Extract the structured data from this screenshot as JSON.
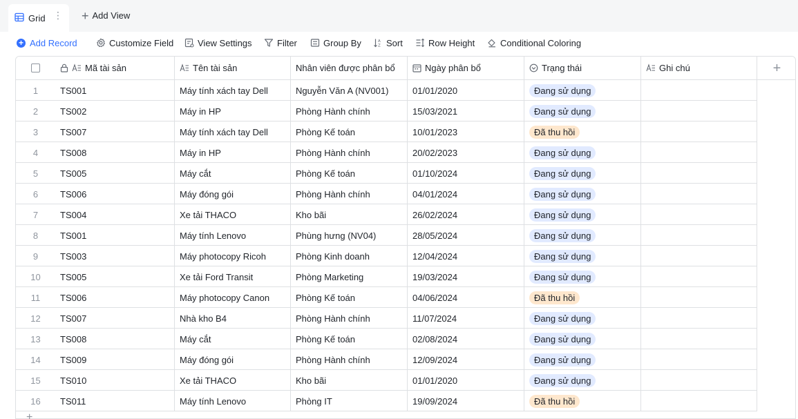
{
  "view": {
    "tab_label": "Grid",
    "more_label": "⋮",
    "add_view_label": "Add View"
  },
  "toolbar": {
    "add_record": "Add Record",
    "customize_field": "Customize Field",
    "view_settings": "View Settings",
    "filter": "Filter",
    "group_by": "Group By",
    "sort": "Sort",
    "row_height": "Row Height",
    "conditional_coloring": "Conditional Coloring"
  },
  "columns": {
    "ma_tai_san": "Mã tài sản",
    "ten_tai_san": "Tên tài sản",
    "nhan_vien": "Nhân viên được phân bổ",
    "ngay_phan_bo": "Ngày phân bổ",
    "trang_thai": "Trạng thái",
    "ghi_chu": "Ghi chú"
  },
  "colors": {
    "accent": "#3370ff",
    "status_in_use_bg": "#e1eaff",
    "status_recalled_bg": "#fee7cd",
    "border": "#dee0e3"
  },
  "rows": [
    {
      "num": "1",
      "code": "TS001",
      "name": "Máy tính xách tay Dell",
      "staff": "Nguyễn Văn A (NV001)",
      "date": "01/01/2020",
      "status": "Đang sử dụng",
      "status_kind": "blue",
      "note": ""
    },
    {
      "num": "2",
      "code": "TS002",
      "name": "Máy in HP",
      "staff": "Phòng Hành chính",
      "date": "15/03/2021",
      "status": "Đang sử dụng",
      "status_kind": "blue",
      "note": ""
    },
    {
      "num": "3",
      "code": "TS007",
      "name": "Máy tính xách tay Dell",
      "staff": "Phòng Kế toán",
      "date": "10/01/2023",
      "status": "Đã thu hồi",
      "status_kind": "orange",
      "note": ""
    },
    {
      "num": "4",
      "code": "TS008",
      "name": "Máy in HP",
      "staff": "Phòng Hành chính",
      "date": "20/02/2023",
      "status": "Đang sử dụng",
      "status_kind": "blue",
      "note": ""
    },
    {
      "num": "5",
      "code": "TS005",
      "name": "Máy cắt",
      "staff": "Phòng Kế toán",
      "date": "01/10/2024",
      "status": "Đang sử dụng",
      "status_kind": "blue",
      "note": ""
    },
    {
      "num": "6",
      "code": "TS006",
      "name": "Máy đóng gói",
      "staff": "Phòng Hành chính",
      "date": "04/01/2024",
      "status": "Đang sử dụng",
      "status_kind": "blue",
      "note": ""
    },
    {
      "num": "7",
      "code": "TS004",
      "name": "Xe tải THACO",
      "staff": "Kho bãi",
      "date": "26/02/2024",
      "status": "Đang sử dụng",
      "status_kind": "blue",
      "note": ""
    },
    {
      "num": "8",
      "code": "TS001",
      "name": "Máy tính Lenovo",
      "staff": "Phùng hưng (NV04)",
      "date": "28/05/2024",
      "status": "Đang sử dụng",
      "status_kind": "blue",
      "note": ""
    },
    {
      "num": "9",
      "code": "TS003",
      "name": "Máy photocopy Ricoh",
      "staff": "Phòng Kinh doanh",
      "date": "12/04/2024",
      "status": "Đang sử dụng",
      "status_kind": "blue",
      "note": ""
    },
    {
      "num": "10",
      "code": "TS005",
      "name": "Xe tải Ford Transit",
      "staff": "Phòng Marketing",
      "date": "19/03/2024",
      "status": "Đang sử dụng",
      "status_kind": "blue",
      "note": ""
    },
    {
      "num": "11",
      "code": "TS006",
      "name": "Máy photocopy Canon",
      "staff": "Phòng Kế toán",
      "date": "04/06/2024",
      "status": "Đã thu hồi",
      "status_kind": "orange",
      "note": ""
    },
    {
      "num": "12",
      "code": "TS007",
      "name": "Nhà kho B4",
      "staff": "Phòng Hành chính",
      "date": "11/07/2024",
      "status": "Đang sử dụng",
      "status_kind": "blue",
      "note": ""
    },
    {
      "num": "13",
      "code": "TS008",
      "name": "Máy cắt",
      "staff": "Phòng Kế toán",
      "date": "02/08/2024",
      "status": "Đang sử dụng",
      "status_kind": "blue",
      "note": ""
    },
    {
      "num": "14",
      "code": "TS009",
      "name": "Máy đóng gói",
      "staff": "Phòng Hành chính",
      "date": "12/09/2024",
      "status": "Đang sử dụng",
      "status_kind": "blue",
      "note": ""
    },
    {
      "num": "15",
      "code": "TS010",
      "name": "Xe tải THACO",
      "staff": "Kho bãi",
      "date": "01/01/2020",
      "status": "Đang sử dụng",
      "status_kind": "blue",
      "note": ""
    },
    {
      "num": "16",
      "code": "TS011",
      "name": "Máy tính Lenovo",
      "staff": "Phòng IT",
      "date": "19/09/2024",
      "status": "Đã thu hồi",
      "status_kind": "orange",
      "note": ""
    }
  ]
}
